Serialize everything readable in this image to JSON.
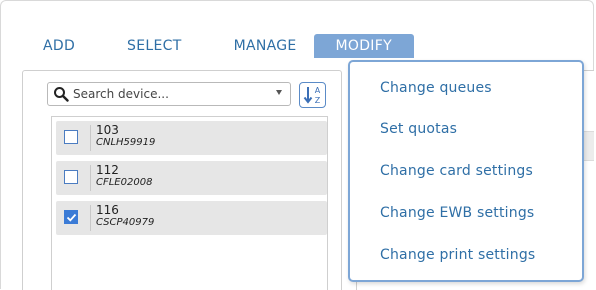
{
  "menu": {
    "tabs": [
      {
        "label": "ADD"
      },
      {
        "label": "SELECT"
      },
      {
        "label": "MANAGE"
      },
      {
        "label": "MODIFY",
        "active": true
      }
    ]
  },
  "search": {
    "placeholder": "Search device...",
    "value": ""
  },
  "sort": {
    "icon": "sort-alpha-icon",
    "letters_top": "A",
    "letters_bottom": "Z"
  },
  "devices": [
    {
      "number": "103",
      "serial": "CNLH59919",
      "checked": false
    },
    {
      "number": "112",
      "serial": "CFLE02008",
      "checked": false
    },
    {
      "number": "116",
      "serial": "CSCP40979",
      "checked": true
    }
  ],
  "modify_menu": {
    "items": [
      {
        "label": "Change queues"
      },
      {
        "label": "Set quotas"
      },
      {
        "label": "Change card settings"
      },
      {
        "label": "Change EWB settings"
      },
      {
        "label": "Change print settings"
      }
    ]
  },
  "colors": {
    "accent": "#2f6fa6",
    "active_tab": "#7da6d6",
    "checkbox_checked": "#3b7bd6",
    "row_bg": "#e6e6e6"
  }
}
